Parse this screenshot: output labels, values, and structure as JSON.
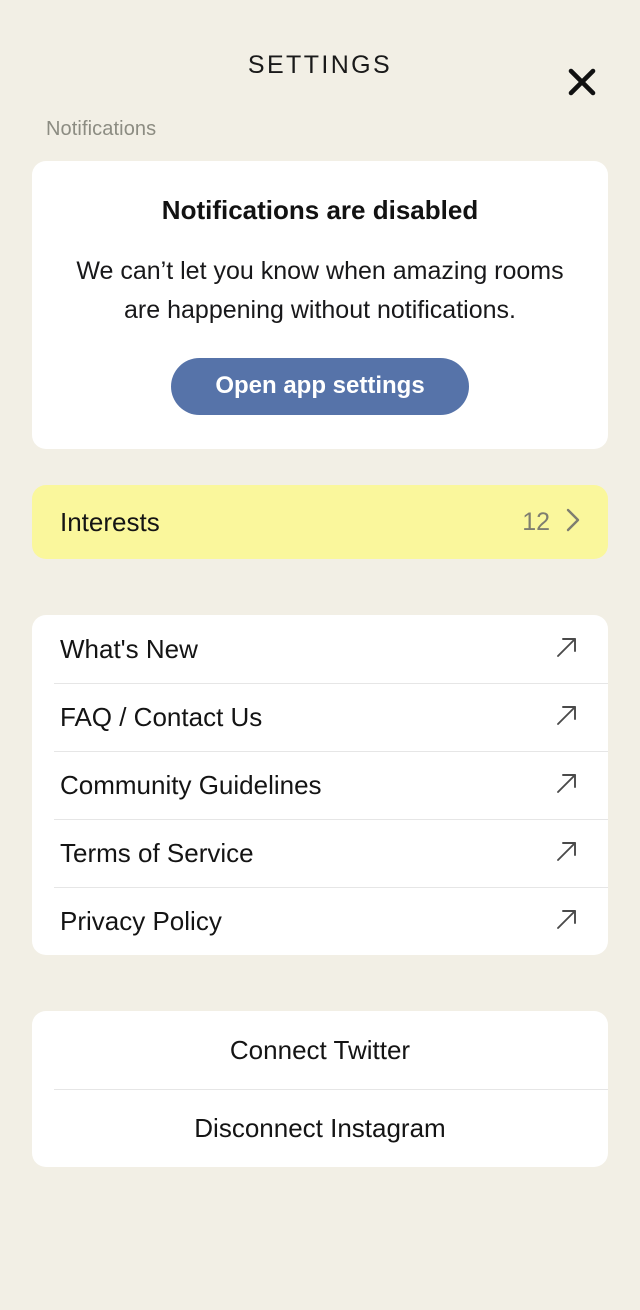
{
  "header": {
    "title": "SETTINGS",
    "close_icon": "close-icon"
  },
  "colors": {
    "page_background": "#f2efe5",
    "card_background": "#ffffff",
    "accent_button": "#5673a9",
    "highlight_row": "#faf79c",
    "muted_text": "#8c8c82",
    "divider": "#e6e6e6"
  },
  "notifications_section": {
    "label": "Notifications",
    "card": {
      "title": "Notifications are disabled",
      "body": "We can’t let you know when amazing rooms are happening without notifications.",
      "button_label": "Open app settings"
    }
  },
  "interests_row": {
    "label": "Interests",
    "count": "12",
    "chevron_icon": "chevron-right-icon"
  },
  "links": [
    {
      "label": "What's New",
      "icon": "external-link-icon"
    },
    {
      "label": "FAQ / Contact Us",
      "icon": "external-link-icon"
    },
    {
      "label": "Community Guidelines",
      "icon": "external-link-icon"
    },
    {
      "label": "Terms of Service",
      "icon": "external-link-icon"
    },
    {
      "label": "Privacy Policy",
      "icon": "external-link-icon"
    }
  ],
  "social_actions": [
    {
      "label": "Connect Twitter"
    },
    {
      "label": "Disconnect Instagram"
    }
  ]
}
